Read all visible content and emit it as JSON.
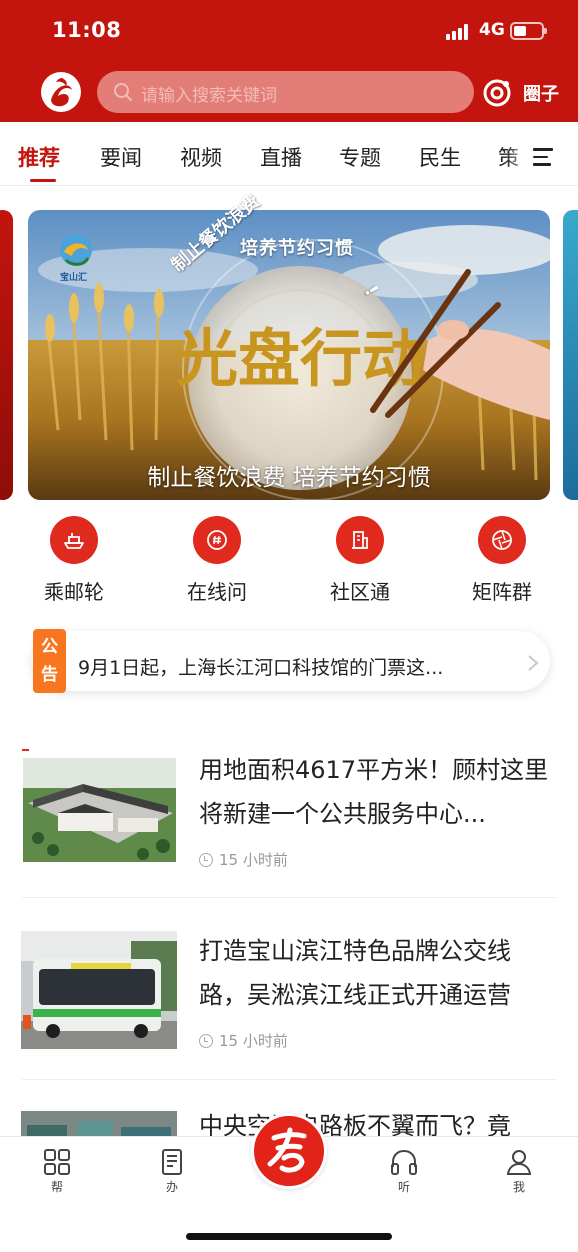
{
  "status_bar": {
    "time": "11:08",
    "network": "4G"
  },
  "header": {
    "search_placeholder": "请输入搜索关键词",
    "circle_label": "圈子"
  },
  "tabs": [
    {
      "label": "推荐",
      "active": true
    },
    {
      "label": "要闻"
    },
    {
      "label": "视频"
    },
    {
      "label": "直播"
    },
    {
      "label": "专题"
    },
    {
      "label": "民生"
    },
    {
      "label": "策"
    }
  ],
  "banner": {
    "headline_image_text": "光盘行动",
    "arc_left": "制止餐饮浪费",
    "arc_top": "培养节约习惯",
    "arc_right": "!",
    "caption": "制止餐饮浪费 培养节约习惯",
    "brand": "宝山汇"
  },
  "quick_entries": [
    {
      "label": "乘邮轮",
      "icon": "ship-icon"
    },
    {
      "label": "在线问",
      "icon": "hashtag-chat-icon"
    },
    {
      "label": "社区通",
      "icon": "building-icon"
    },
    {
      "label": "矩阵群",
      "icon": "aperture-icon"
    }
  ],
  "notice": {
    "badge": "公告",
    "text": "9月1日起，上海长江河口科技馆的门票这..."
  },
  "news": [
    {
      "title": "用地面积4617平方米！顾村这里将新建一个公共服务中心...",
      "time": "15 小时前",
      "thumb": "building-rendering"
    },
    {
      "title": "打造宝山滨江特色品牌公交线路，吴淞滨江线正式开通运营",
      "time": "15 小时前",
      "thumb": "bus"
    },
    {
      "title": "中央空调电路板不翼而飞？竟",
      "time": "",
      "thumb": "rooftop-equipment"
    }
  ],
  "bottom_nav": [
    {
      "label": "帮",
      "icon": "grid-icon"
    },
    {
      "label": "办",
      "icon": "book-icon"
    },
    {
      "label": "",
      "icon": "kan-logo-icon"
    },
    {
      "label": "听",
      "icon": "headphones-icon"
    },
    {
      "label": "我",
      "icon": "user-icon"
    }
  ],
  "colors": {
    "brand_red": "#c4140e",
    "notice_orange": "#f7761f"
  }
}
